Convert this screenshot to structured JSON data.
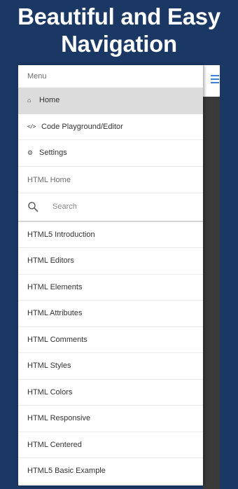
{
  "promo": {
    "line1": "Beautiful and Easy",
    "line2": "Navigation"
  },
  "drawer": {
    "menu_header": "Menu",
    "items": [
      {
        "label": "Home",
        "icon": "home-icon",
        "active": true
      },
      {
        "label": "Code Playground/Editor",
        "icon": "code-icon",
        "active": false
      },
      {
        "label": "Settings",
        "icon": "gear-icon",
        "active": false
      }
    ],
    "section_label": "HTML Home",
    "search": {
      "placeholder": "Search",
      "value": ""
    },
    "topics": [
      "HTML5 Introduction",
      "HTML Editors",
      "HTML Elements",
      "HTML Attributes",
      "HTML Comments",
      "HTML Styles",
      "HTML Colors",
      "HTML Responsive",
      "HTML Centered",
      "HTML5 Basic Example"
    ]
  },
  "colors": {
    "background": "#1b3763",
    "active_item": "#dcdcdc",
    "accent": "#3d82d6",
    "app_content": "#3a3a3a"
  }
}
